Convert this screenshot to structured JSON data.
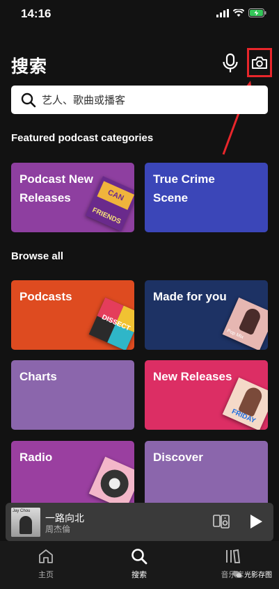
{
  "status": {
    "time": "14:16"
  },
  "header": {
    "title": "搜索"
  },
  "search": {
    "placeholder": "艺人、歌曲或播客"
  },
  "sections": {
    "featured": "Featured podcast categories",
    "browse": "Browse all"
  },
  "featured_tiles": [
    {
      "label": "Podcast New Releases",
      "color": "#8e3fa0"
    },
    {
      "label": "True Crime Scene",
      "color": "#3b46b8"
    }
  ],
  "browse_tiles": [
    {
      "label": "Podcasts",
      "color": "#de4b20"
    },
    {
      "label": "Made for you",
      "color": "#1d3264"
    },
    {
      "label": "Charts",
      "color": "#8b66ac"
    },
    {
      "label": "New Releases",
      "color": "#dc2e64"
    },
    {
      "label": "Radio",
      "color": "#9a3fa0"
    },
    {
      "label": "Discover",
      "color": "#8b66ac"
    }
  ],
  "covers": {
    "friends_text": "FRIENDS",
    "dissect_text": "DISSECT",
    "popmix_text": "Pop Mix",
    "newrel_text": "FRIDAY"
  },
  "player": {
    "title": "一路向北",
    "artist": "周杰倫",
    "album_text": "Jay Chou"
  },
  "tabs": [
    {
      "label": "主页"
    },
    {
      "label": "搜索"
    },
    {
      "label": "音乐库"
    }
  ],
  "watermark": "光影存图",
  "colors": {
    "accent": "#1db954",
    "highlight": "#e8262b",
    "background": "#121212"
  }
}
